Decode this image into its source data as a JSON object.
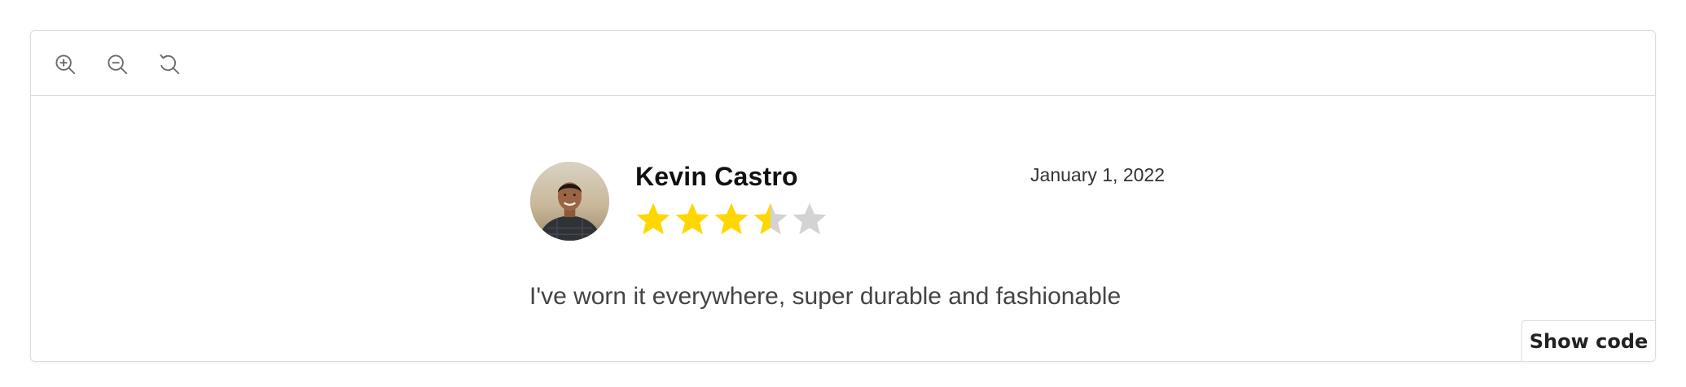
{
  "toolbar": {
    "icons": [
      "zoom-in-icon",
      "zoom-out-icon",
      "reset-zoom-icon"
    ]
  },
  "review": {
    "reviewer_name": "Kevin Castro",
    "date": "January 1, 2022",
    "rating": 3.5,
    "max_rating": 5,
    "comment": "I've worn it everywhere, super durable and fashionable"
  },
  "colors": {
    "star_filled": "#FFD700",
    "star_empty": "#D3D3D3",
    "border": "#DCDCDC"
  },
  "footer": {
    "show_code_label": "Show code"
  }
}
